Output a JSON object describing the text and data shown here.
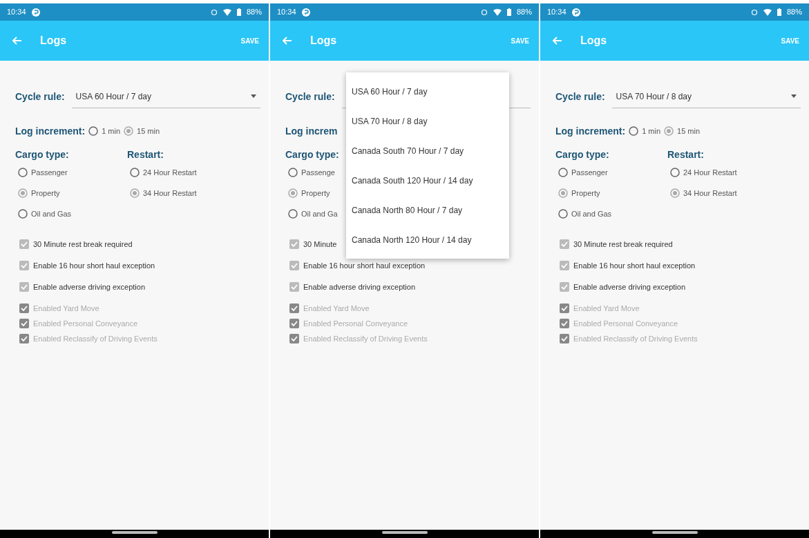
{
  "screens": [
    {
      "status_bar": {
        "time": "10:34",
        "battery": "88%"
      },
      "app_bar": {
        "title": "Logs",
        "action": "SAVE"
      },
      "cycle_rule": {
        "label": "Cycle rule:",
        "value": "USA 60 Hour / 7 day"
      },
      "log_increment": {
        "label": "Log increment:",
        "options": [
          {
            "label": "1 min",
            "selected": false
          },
          {
            "label": "15 min",
            "selected": true
          }
        ]
      },
      "cargo_type": {
        "label": "Cargo type:",
        "options": [
          {
            "label": "Passenger",
            "selected": false
          },
          {
            "label": "Property",
            "selected": true
          },
          {
            "label": "Oil and Gas",
            "selected": false
          }
        ]
      },
      "restart": {
        "label": "Restart:",
        "options": [
          {
            "label": "24 Hour Restart",
            "selected": false
          },
          {
            "label": "34 Hour Restart",
            "selected": true
          }
        ]
      },
      "checkboxes": [
        {
          "label": "30 Minute rest break required",
          "checked": true,
          "disabled": false
        },
        {
          "label": "Enable 16 hour short haul exception",
          "checked": true,
          "disabled": false
        },
        {
          "label": "Enable adverse driving exception",
          "checked": true,
          "disabled": false
        },
        {
          "label": "Enabled Yard Move",
          "checked": true,
          "disabled": true
        },
        {
          "label": "Enabled Personal Conveyance",
          "checked": true,
          "disabled": true
        },
        {
          "label": "Enabled Reclassify of Driving Events",
          "checked": true,
          "disabled": true
        }
      ]
    },
    {
      "status_bar": {
        "time": "10:34",
        "battery": "88%"
      },
      "app_bar": {
        "title": "Logs",
        "action": "SAVE"
      },
      "cycle_rule": {
        "label": "Cycle rule:"
      },
      "log_increment": {
        "label": "Log increm"
      },
      "cargo_type": {
        "label": "Cargo type:",
        "options": [
          {
            "label": "Passenge",
            "selected": false
          },
          {
            "label": "Property",
            "selected": true
          },
          {
            "label": "Oil and Ga",
            "selected": false
          }
        ]
      },
      "checkboxes": [
        {
          "label": "30 Minute",
          "checked": true,
          "disabled": false
        },
        {
          "label": "Enable 16 hour short haul exception",
          "checked": true,
          "disabled": false
        },
        {
          "label": "Enable adverse driving exception",
          "checked": true,
          "disabled": false
        },
        {
          "label": "Enabled Yard Move",
          "checked": true,
          "disabled": true
        },
        {
          "label": "Enabled Personal Conveyance",
          "checked": true,
          "disabled": true
        },
        {
          "label": "Enabled Reclassify of Driving Events",
          "checked": true,
          "disabled": true
        }
      ],
      "dropdown_menu": {
        "options": [
          {
            "label": "USA 60 Hour / 7 day"
          },
          {
            "label": "USA 70 Hour / 8 day"
          },
          {
            "label": "Canada South 70 Hour / 7 day"
          },
          {
            "label": "Canada South 120 Hour / 14 day"
          },
          {
            "label": "Canada North 80 Hour / 7 day"
          },
          {
            "label": "Canada North 120 Hour / 14 day"
          }
        ]
      }
    },
    {
      "status_bar": {
        "time": "10:34",
        "battery": "88%"
      },
      "app_bar": {
        "title": "Logs",
        "action": "SAVE"
      },
      "cycle_rule": {
        "label": "Cycle rule:",
        "value": "USA 70 Hour / 8 day"
      },
      "log_increment": {
        "label": "Log increment:",
        "options": [
          {
            "label": "1 min",
            "selected": false
          },
          {
            "label": "15 min",
            "selected": true
          }
        ]
      },
      "cargo_type": {
        "label": "Cargo type:",
        "options": [
          {
            "label": "Passenger",
            "selected": false
          },
          {
            "label": "Property",
            "selected": true
          },
          {
            "label": "Oil and Gas",
            "selected": false
          }
        ]
      },
      "restart": {
        "label": "Restart:",
        "options": [
          {
            "label": "24 Hour Restart",
            "selected": false
          },
          {
            "label": "34 Hour Restart",
            "selected": true
          }
        ]
      },
      "checkboxes": [
        {
          "label": "30 Minute rest break required",
          "checked": true,
          "disabled": false
        },
        {
          "label": "Enable 16 hour short haul exception",
          "checked": true,
          "disabled": false
        },
        {
          "label": "Enable adverse driving exception",
          "checked": true,
          "disabled": false
        },
        {
          "label": "Enabled Yard Move",
          "checked": true,
          "disabled": true
        },
        {
          "label": "Enabled Personal Conveyance",
          "checked": true,
          "disabled": true
        },
        {
          "label": "Enabled Reclassify of Driving Events",
          "checked": true,
          "disabled": true
        }
      ]
    }
  ]
}
